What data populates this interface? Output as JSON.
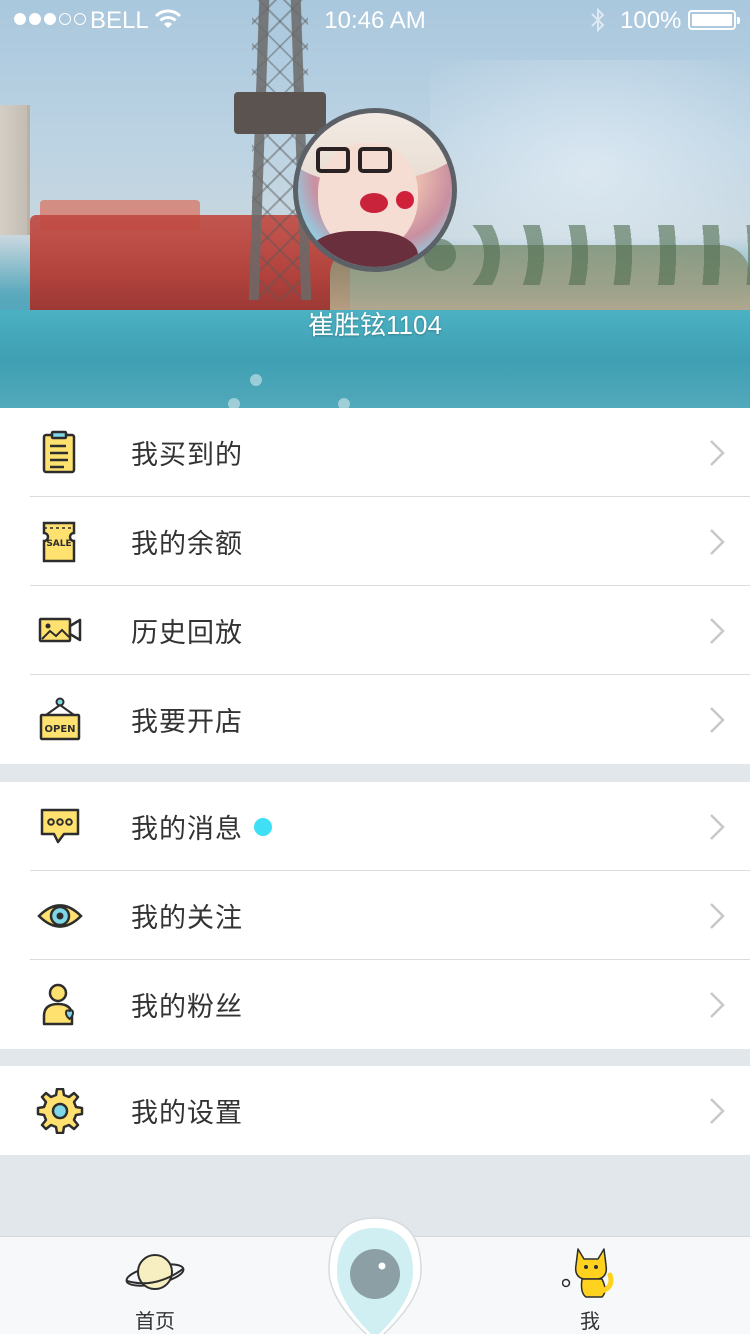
{
  "status_bar": {
    "carrier": "BELL",
    "time": "10:46 AM",
    "battery": "100%",
    "battery_level": 1.0,
    "signal_bars": 3,
    "signal_total": 5
  },
  "profile": {
    "username": "崔胜铉1104"
  },
  "menu_groups": [
    {
      "items": [
        {
          "label": "我买到的",
          "icon": "clipboard-icon"
        },
        {
          "label": "我的余额",
          "icon": "sale-ticket-icon"
        },
        {
          "label": "历史回放",
          "icon": "video-camera-icon"
        },
        {
          "label": "我要开店",
          "icon": "open-sign-icon"
        }
      ]
    },
    {
      "items": [
        {
          "label": "我的消息",
          "icon": "chat-bubble-icon",
          "badge_color": "#3fe0f5"
        },
        {
          "label": "我的关注",
          "icon": "eye-icon"
        },
        {
          "label": "我的粉丝",
          "icon": "fan-user-icon"
        }
      ]
    },
    {
      "items": [
        {
          "label": "我的设置",
          "icon": "gear-icon"
        }
      ]
    }
  ],
  "tab_bar": {
    "home_label": "首页",
    "me_label": "我",
    "home_icon": "planet-icon",
    "center_icon": "location-pin-icon",
    "me_icon": "cat-mascot-icon"
  },
  "colors": {
    "accent_yellow": "#ffe170",
    "icon_stroke": "#2d2d2d",
    "badge_cyan": "#3fe0f5",
    "background": "#e1e7ea"
  }
}
